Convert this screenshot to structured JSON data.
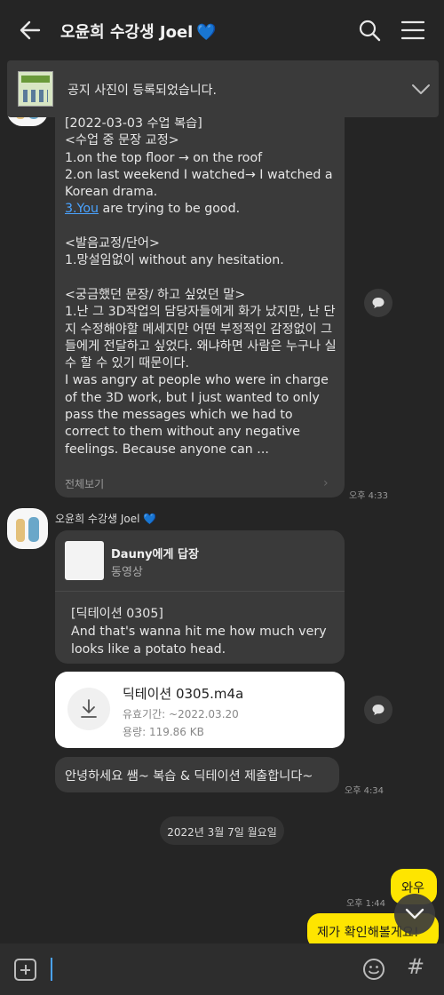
{
  "header": {
    "title": "오윤희 수강생 Joel",
    "heart": "💙",
    "back_icon": "back-arrow-icon",
    "search_icon": "search-icon",
    "menu_icon": "menu-icon"
  },
  "notice": {
    "text": "공지 사진이 등록되었습니다.",
    "expand_icon": "chevron-down-icon"
  },
  "messages": {
    "long": {
      "text": "[2022-03-03 수업 복습]\n<수업 중 문장 교정>\n1.on the top floor → on the roof\n2.on last weekend I watched→ I watched a Korean drama.",
      "link": "3.You",
      "after_link": " are trying to be good.\n\n<발음교정/단어>\n1.망설임없이 without any hesitation.\n\n<궁금했던 문장/ 하고 싶었던 말>\n1.난 그 3D작업의 담당자들에게 화가 났지만, 난 단지 수정해야할 메세지만 어떤 부정적인 감정없이 그들에게 전달하고 싶었다. 왜냐하면 사람은 누구나 실수 할 수 있기 때문이다.\nI was angry at people who were in charge of the 3D work, but I just wanted to only pass the messages which we had to correct to them without any negative feelings. Because anyone can ...",
      "see_more": "전체보기",
      "time": "오후 4:33"
    },
    "sender_name": "오윤희 수강생 Joel 💙",
    "reply": {
      "to": "Dauny에게 답장",
      "kind": "동영상",
      "text": "[딕테이션 0305]\nAnd that's wanna hit me how much very looks like a potato head."
    },
    "file": {
      "name": "딕테이션 0305.m4a",
      "expiry": "유효기간: ~2022.03.20",
      "size": "용량: 119.86 KB"
    },
    "greeting": {
      "text": "안녕하세요 쌤~ 복습 & 딕테이션 제출합니다~",
      "time": "오후 4:34"
    },
    "date_divider": "2022년 3월 7일 월요일",
    "mine": [
      {
        "text": "와우",
        "time": "오후 1:44"
      },
      {
        "text": "제가 확인해볼게요!"
      }
    ]
  },
  "input": {
    "placeholder": "",
    "plus_icon": "plus-icon",
    "emoji_icon": "emoji-icon",
    "hash": "#"
  },
  "colors": {
    "background": "#252525",
    "bubble": "#3a3a3a",
    "my_bubble": "#fee500",
    "link": "#4aa3ff"
  }
}
